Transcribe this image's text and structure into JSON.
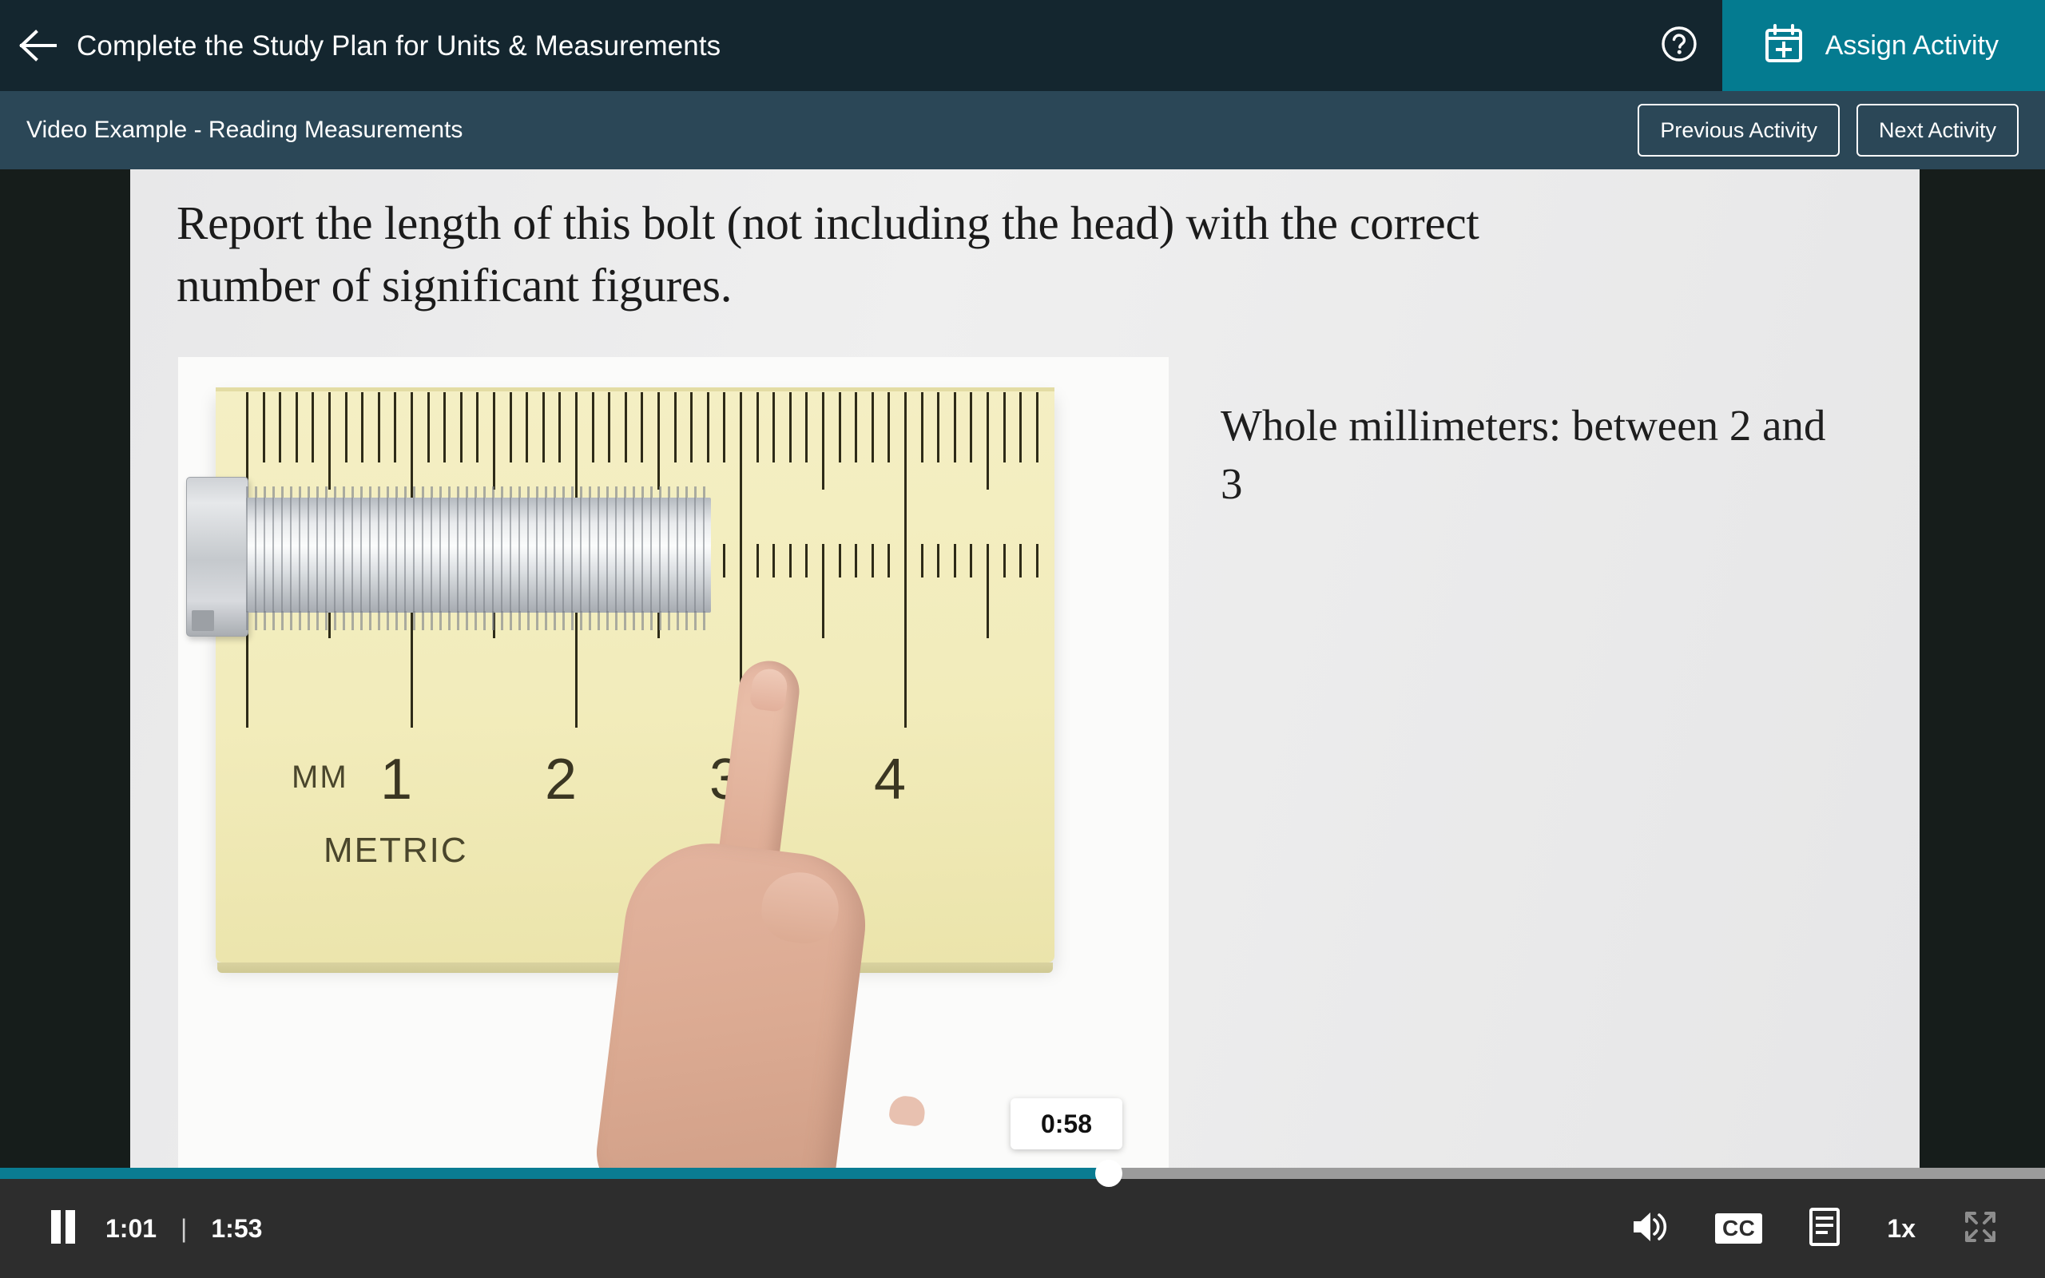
{
  "header": {
    "back_icon": "arrow-left-icon",
    "title": "Complete the Study Plan for Units & Measurements",
    "help_icon": "help-circle-icon",
    "assign": {
      "icon": "calendar-plus-icon",
      "label": "Assign Activity"
    },
    "colors": {
      "top_bar_bg": "#14262f",
      "sub_bar_bg": "#2b4757",
      "accent_teal": "#047b90"
    }
  },
  "subheader": {
    "title": "Video Example - Reading Measurements",
    "previous_label": "Previous Activity",
    "next_label": "Next Activity"
  },
  "slide": {
    "question": "Report the length of this bolt (not including the head) with the correct number of significant figures.",
    "annotation": "Whole millimeters: between 2 and 3",
    "ruler": {
      "unit_label": "MM",
      "system_label": "METRIC",
      "numbers": [
        "1",
        "2",
        "3",
        "4"
      ]
    }
  },
  "player": {
    "play_state_icon": "pause-icon",
    "current_time": "1:01",
    "separator": "|",
    "total_time": "1:53",
    "hover_tooltip_time": "0:58",
    "progress_percent": 54.2,
    "volume_icon": "volume-high-icon",
    "captions_label": "CC",
    "transcript_icon": "transcript-icon",
    "speed_label": "1x",
    "fullscreen_icon": "fullscreen-expand-icon",
    "colors": {
      "bar_bg": "#2d2d2d",
      "progress_fill": "#0a7c92",
      "progress_track": "#9b9b9b"
    }
  }
}
